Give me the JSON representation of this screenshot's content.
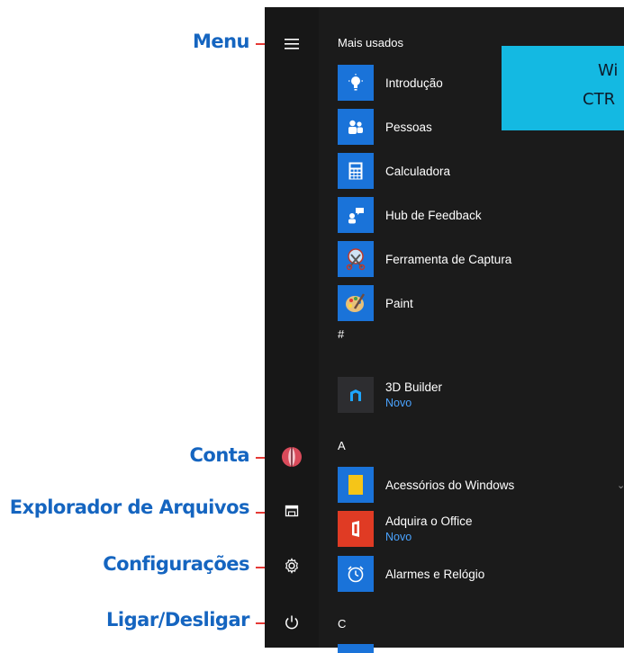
{
  "annotations": {
    "menu": "Menu",
    "conta": "Conta",
    "explorador": "Explorador de Arquivos",
    "configuracoes": "Configurações",
    "ligar": "Ligar/Desligar"
  },
  "tile_text": {
    "line1": "Wi",
    "line2": "CTR"
  },
  "sections": {
    "most_used": "Mais usados",
    "hash": "#",
    "a": "A",
    "c": "C"
  },
  "apps": {
    "introducao": {
      "name": "Introdução",
      "icon": "lightbulb-icon"
    },
    "pessoas": {
      "name": "Pessoas",
      "icon": "people-icon"
    },
    "calculadora": {
      "name": "Calculadora",
      "icon": "calculator-icon"
    },
    "hub": {
      "name": "Hub de Feedback",
      "icon": "feedback-icon"
    },
    "ferramenta": {
      "name": "Ferramenta de Captura",
      "icon": "scissors-icon"
    },
    "paint": {
      "name": "Paint",
      "icon": "palette-icon"
    },
    "builder": {
      "name": "3D Builder",
      "sub": "Novo",
      "icon": "3d-builder-icon"
    },
    "acessorios": {
      "name": "Acessórios do Windows",
      "icon": "folder-icon"
    },
    "office": {
      "name": "Adquira o Office",
      "sub": "Novo",
      "icon": "office-icon"
    },
    "alarmes": {
      "name": "Alarmes e Relógio",
      "icon": "clock-icon"
    }
  },
  "colors": {
    "tile_blue": "#1a73d9",
    "office_red": "#e03b24",
    "annotation_blue": "#1565c0",
    "annotation_red": "#e53935",
    "accent_cyan": "#14b9e2",
    "menu_bg": "#1b1b1b"
  }
}
